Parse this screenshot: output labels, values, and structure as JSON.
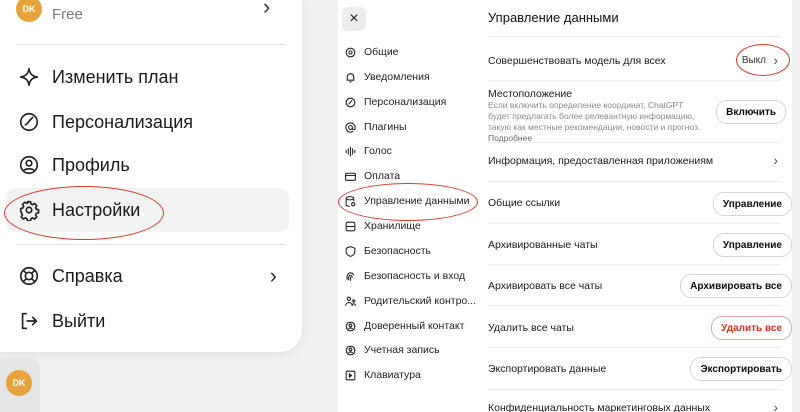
{
  "account": {
    "avatar": "DK",
    "plan": "Free"
  },
  "menu": {
    "items": [
      {
        "label": "Изменить план",
        "icon": "sparkle-icon"
      },
      {
        "label": "Персонализация",
        "icon": "personalization-icon"
      },
      {
        "label": "Профиль",
        "icon": "profile-icon"
      },
      {
        "label": "Настройки",
        "icon": "gear-icon",
        "active": true
      },
      {
        "label": "Справка",
        "icon": "lifebuoy-icon",
        "chevron": "›"
      },
      {
        "label": "Выйти",
        "icon": "logout-icon"
      }
    ]
  },
  "bottom_avatar": "DK",
  "settings": {
    "close_label": "×",
    "nav": [
      {
        "label": "Общие",
        "icon": "gear-icon"
      },
      {
        "label": "Уведомления",
        "icon": "bell-icon"
      },
      {
        "label": "Персонализация",
        "icon": "personalization-icon"
      },
      {
        "label": "Плагины",
        "icon": "at-icon"
      },
      {
        "label": "Голос",
        "icon": "voice-icon"
      },
      {
        "label": "Оплата",
        "icon": "card-icon"
      },
      {
        "label": "Управление данными",
        "icon": "data-icon",
        "active": true
      },
      {
        "label": "Хранилище",
        "icon": "storage-icon"
      },
      {
        "label": "Безопасность",
        "icon": "shield-icon"
      },
      {
        "label": "Безопасность и вход",
        "icon": "fingerprint-icon"
      },
      {
        "label": "Родительский контро...",
        "icon": "parental-icon"
      },
      {
        "label": "Доверенный контакт",
        "icon": "trusted-contact-icon"
      },
      {
        "label": "Учетная запись",
        "icon": "account-icon"
      },
      {
        "label": "Клавиатура",
        "icon": "keyboard-icon"
      }
    ],
    "title": "Управление данными",
    "rows": {
      "improve_model": {
        "label": "Совершенствовать модель для всех",
        "value": "Выкл",
        "chevron": "›"
      },
      "location": {
        "label": "Местоположение",
        "description": "Если включить определение координат, ChatGPT будет предлагать более релевантную информацию, такую как местные рекомендации, новости и прогноз.",
        "more_link": "Подробнее",
        "button": "Включить"
      },
      "app_info": {
        "label": "Информация, предоставленная приложениям",
        "chevron": "›"
      },
      "shared_links": {
        "label": "Общие ссылки",
        "button": "Управление"
      },
      "archived_chats": {
        "label": "Архивированные чаты",
        "button": "Управление"
      },
      "archive_all": {
        "label": "Архивировать все чаты",
        "button": "Архивировать все"
      },
      "delete_all": {
        "label": "Удалить все чаты",
        "button": "Удалить все"
      },
      "export": {
        "label": "Экспортировать данные",
        "button": "Экспортировать"
      },
      "privacy": {
        "label": "Конфиденциальность маркетинговых данных",
        "chevron": "›"
      }
    }
  },
  "colors": {
    "highlight_ellipse": "#d23a2a",
    "danger": "#d5321f",
    "avatar": "#e8a33c"
  }
}
